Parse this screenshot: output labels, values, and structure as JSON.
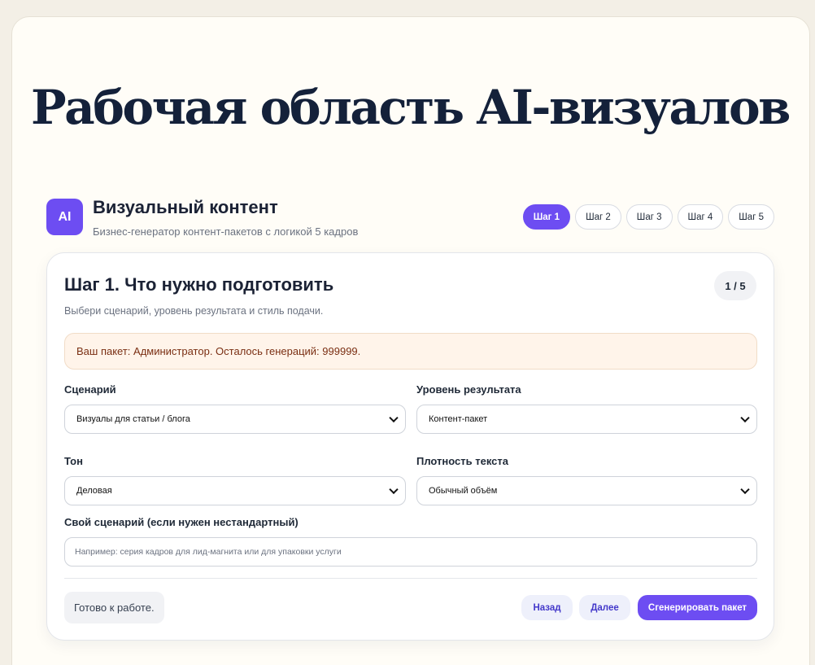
{
  "hero": {
    "title": "Рабочая область AI-визуалов"
  },
  "app": {
    "logo": "AI",
    "title": "Визуальный контент",
    "subtitle": "Бизнес-генератор контент-пакетов с логикой 5 кадров"
  },
  "steps": [
    {
      "label": "Шаг 1",
      "active": true
    },
    {
      "label": "Шаг 2",
      "active": false
    },
    {
      "label": "Шаг 3",
      "active": false
    },
    {
      "label": "Шаг 4",
      "active": false
    },
    {
      "label": "Шаг 5",
      "active": false
    }
  ],
  "form": {
    "title": "Шаг 1. Что нужно подготовить",
    "counter": "1 / 5",
    "subtitle": "Выбери сценарий, уровень результата и стиль подачи.",
    "notice": "Ваш пакет: Администратор. Осталось генераций: 999999.",
    "scenario": {
      "label": "Сценарий",
      "value": "Визуалы для статьи / блога"
    },
    "level": {
      "label": "Уровень результата",
      "value": "Контент-пакет"
    },
    "tone": {
      "label": "Тон",
      "value": "Деловая"
    },
    "density": {
      "label": "Плотность текста",
      "value": "Обычный объём"
    },
    "custom": {
      "label": "Свой сценарий (если нужен нестандартный)",
      "value": "",
      "placeholder": "Например: серия кадров для лид-магнита или для упаковки услуги"
    },
    "status": "Готово к работе.",
    "buttons": {
      "back": "Назад",
      "next": "Далее",
      "generate": "Сгенерировать пакет"
    }
  },
  "colors": {
    "accent": "#6d4df2",
    "page_bg": "#f3efe6",
    "notice_bg": "#fff4ea",
    "notice_text": "#7a2e12"
  }
}
